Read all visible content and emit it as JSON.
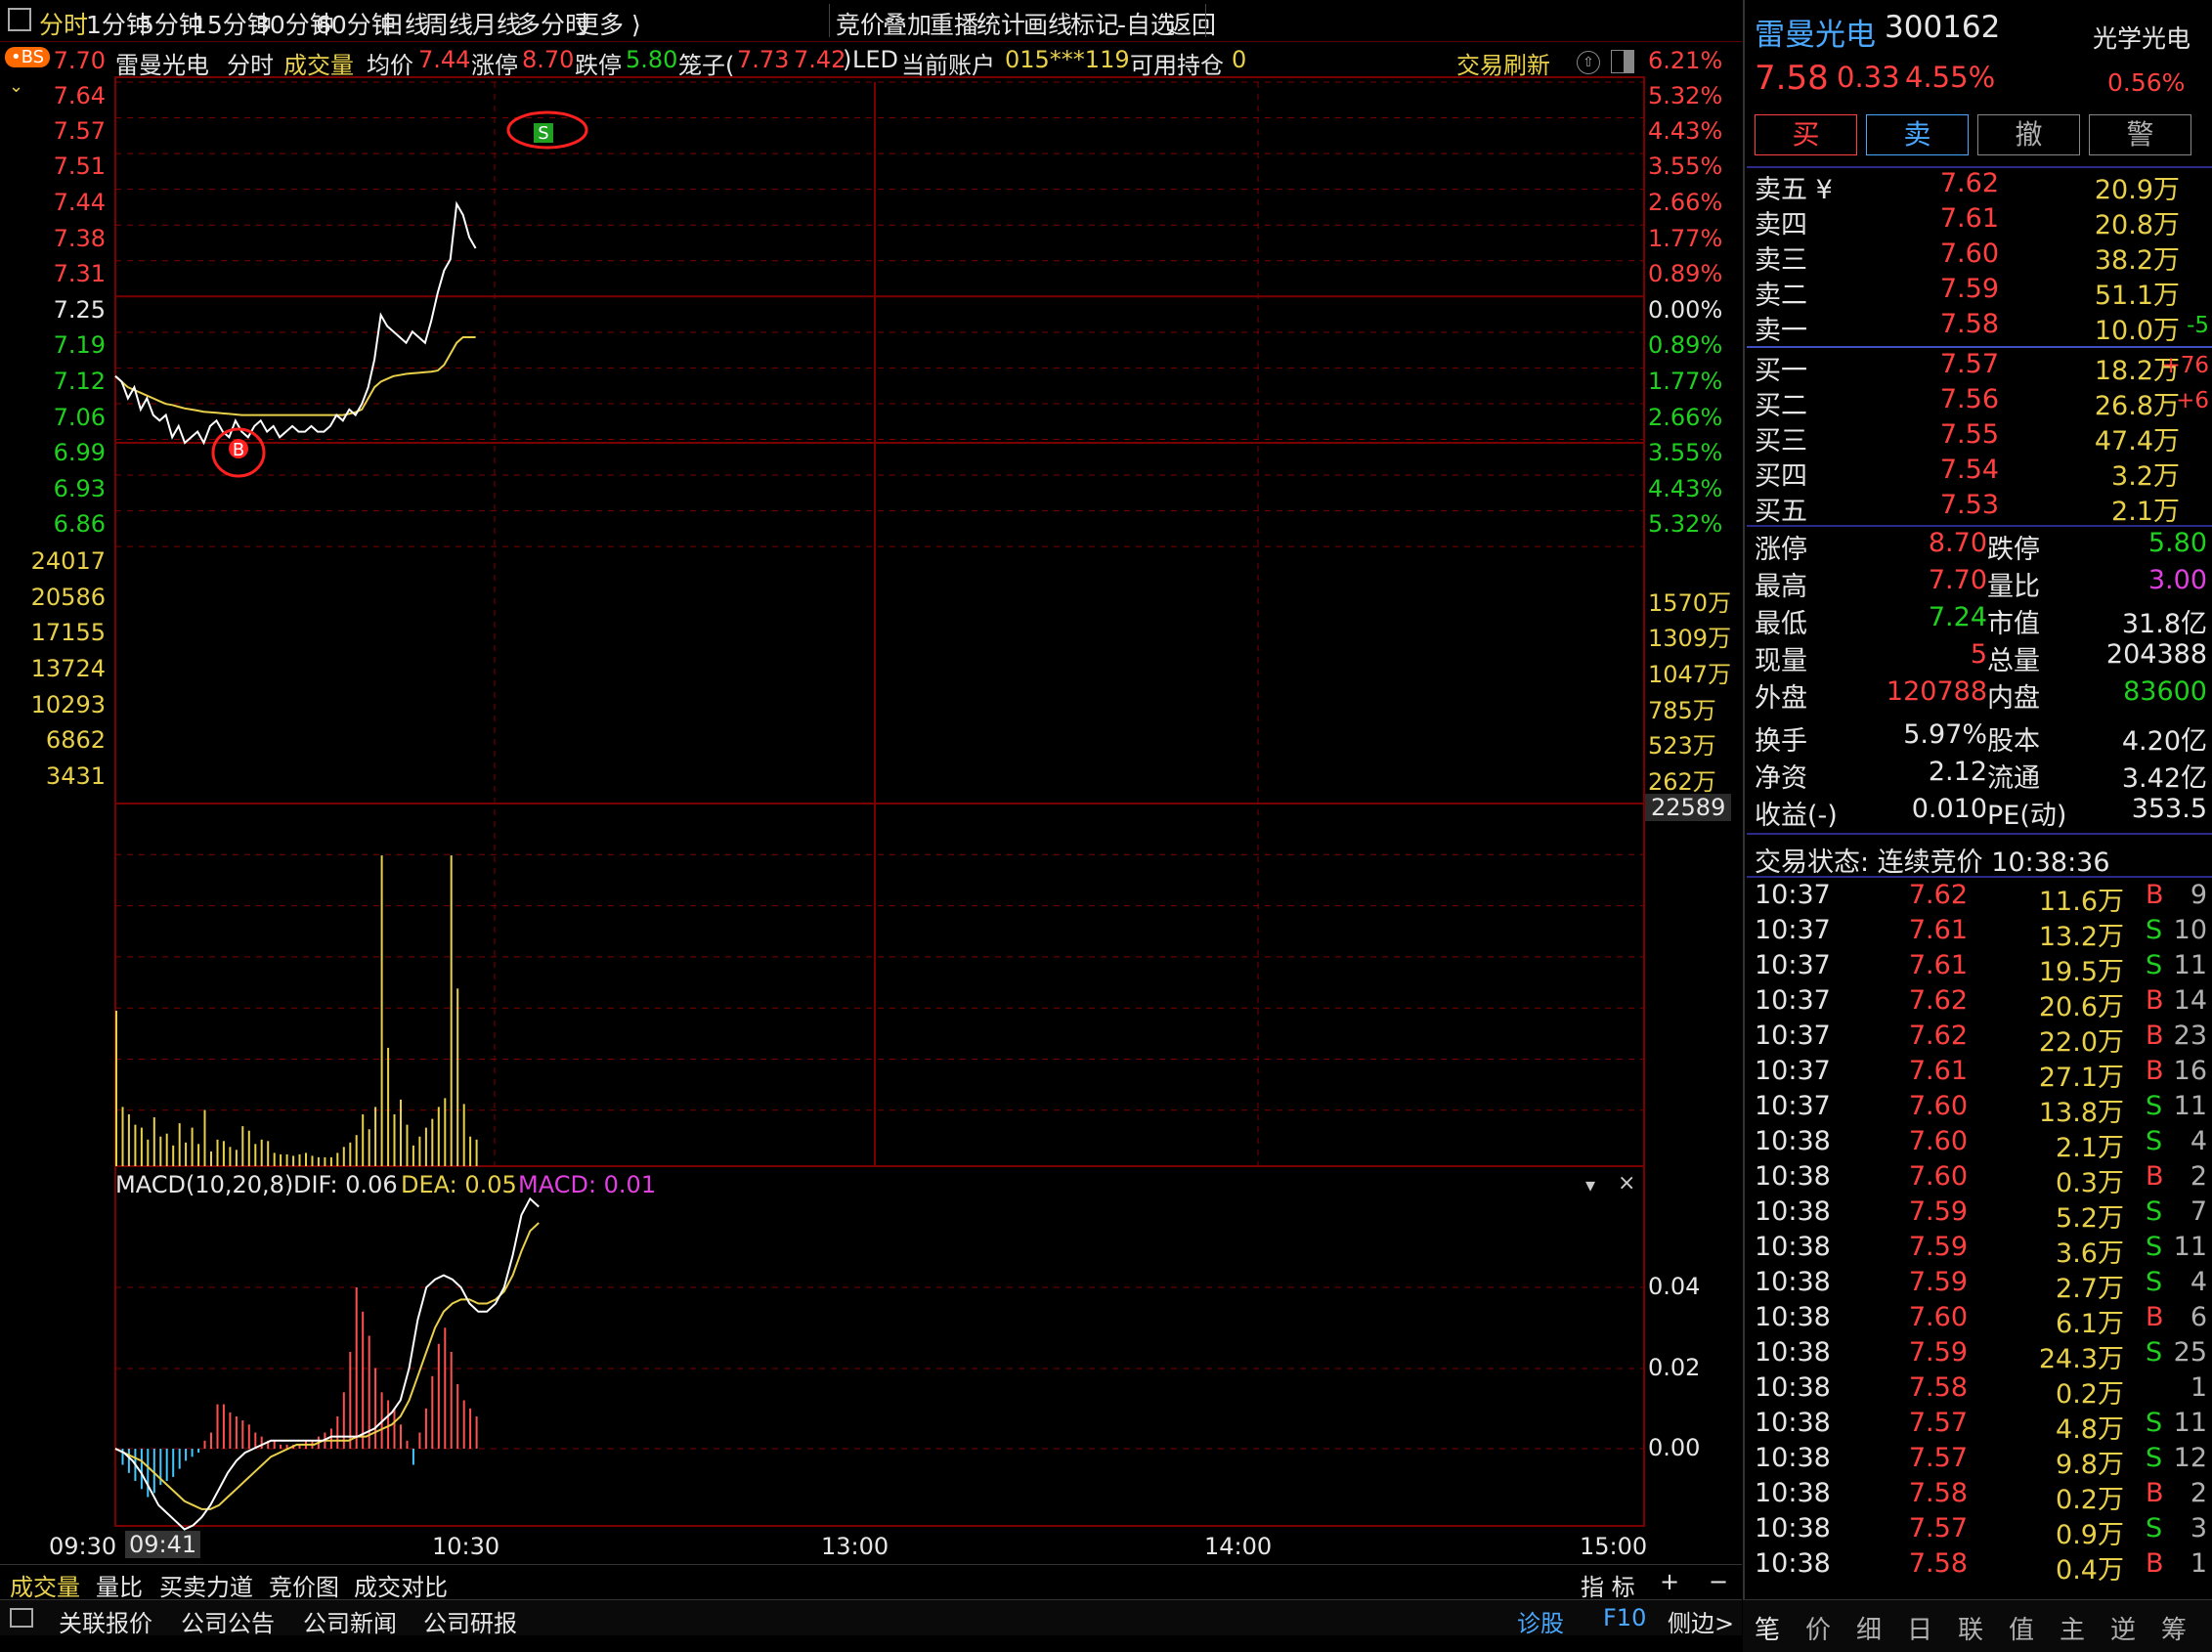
{
  "top_tabs": [
    "分时",
    "1分钟",
    "5分钟",
    "15分钟",
    "30分钟",
    "60分钟",
    "日线",
    "周线",
    "月线",
    "多分时",
    "更多 ⟩"
  ],
  "top_right_tabs": [
    "竞价",
    "叠加",
    "重播",
    "统计",
    "画线",
    "标记",
    "-自选",
    "返回"
  ],
  "bs_badge": "BS",
  "info": {
    "name": "雷曼光电",
    "mode": "分时",
    "indicator": "成交量",
    "avg_label": "均价",
    "avg_value": "7.44",
    "limit_up_label": "涨停",
    "limit_up_value": "8.70",
    "limit_down_label": "跌停",
    "limit_down_value": "5.80",
    "cage_label": "笼子(",
    "cage_high": "7.73",
    "cage_low": "7.42",
    "cage_close": ")",
    "sector": "LED",
    "account_label": "当前账户",
    "account_value": "015***119",
    "position_label": "可用持仓",
    "position_value": "0",
    "refresh": "交易刷新"
  },
  "price_axis": {
    "left_red": [
      "7.70",
      "7.64",
      "7.57",
      "7.51",
      "7.44",
      "7.38",
      "7.31"
    ],
    "left_mid": "7.25",
    "left_green": [
      "7.19",
      "7.12",
      "7.06",
      "6.99",
      "6.93",
      "6.86"
    ],
    "right_red": [
      "6.21%",
      "5.32%",
      "4.43%",
      "3.55%",
      "2.66%",
      "1.77%",
      "0.89%"
    ],
    "right_mid": "0.00%",
    "right_green": [
      "0.89%",
      "1.77%",
      "2.66%",
      "3.55%",
      "4.43%",
      "5.32%"
    ]
  },
  "volume_axis": {
    "left": [
      "24017",
      "20586",
      "17155",
      "13724",
      "10293",
      "6862",
      "3431"
    ],
    "right_box": "22589",
    "right": [
      "1570万",
      "1309万",
      "1047万",
      "785万",
      "523万",
      "262万"
    ]
  },
  "macd": {
    "title": "MACD(10,20,8)",
    "dif": "DIF: 0.06",
    "dea": "DEA: 0.05",
    "macd": "MACD: 0.01",
    "axis": [
      "0.04",
      "0.02",
      "0.00"
    ]
  },
  "time_axis": {
    "t1": "09:30",
    "t1b": "09:41",
    "t2": "10:30",
    "t3": "13:00",
    "t4": "14:00",
    "t5": "15:00"
  },
  "bottom_tabs": [
    "成交量",
    "量比",
    "买卖力道",
    "竞价图",
    "成交对比"
  ],
  "bottom_right": {
    "ind": "指 标",
    "plus": "+",
    "minus": "−"
  },
  "footer_tabs": [
    "关联报价",
    "公司公告",
    "公司新闻",
    "公司研报"
  ],
  "footer_right": {
    "diag": "诊股",
    "f10": "F10",
    "side": "侧边>"
  },
  "stock": {
    "name": "雷曼光电",
    "code": "300162",
    "sector": "光学光电",
    "price": "7.58",
    "change": "0.33",
    "pct": "4.55%",
    "spread": "0.56%",
    "buttons": [
      "买",
      "卖",
      "撤",
      "警"
    ]
  },
  "asks": [
    {
      "label": "卖五 ¥",
      "price": "7.62",
      "vol": "20.9万",
      "chg": ""
    },
    {
      "label": "卖四",
      "price": "7.61",
      "vol": "20.8万",
      "chg": ""
    },
    {
      "label": "卖三",
      "price": "7.60",
      "vol": "38.2万",
      "chg": ""
    },
    {
      "label": "卖二",
      "price": "7.59",
      "vol": "51.1万",
      "chg": ""
    },
    {
      "label": "卖一",
      "price": "7.58",
      "vol": "10.0万",
      "chg": "-5"
    }
  ],
  "bids": [
    {
      "label": "买一",
      "price": "7.57",
      "vol": "18.2万",
      "chg": "+76"
    },
    {
      "label": "买二",
      "price": "7.56",
      "vol": "26.8万",
      "chg": "+6"
    },
    {
      "label": "买三",
      "price": "7.55",
      "vol": "47.4万",
      "chg": ""
    },
    {
      "label": "买四",
      "price": "7.54",
      "vol": "3.2万",
      "chg": ""
    },
    {
      "label": "买五",
      "price": "7.53",
      "vol": "2.1万",
      "chg": ""
    }
  ],
  "stats": [
    {
      "l1": "涨停",
      "v1": "8.70",
      "c1": "red",
      "l2": "跌停",
      "v2": "5.80",
      "c2": "green"
    },
    {
      "l1": "最高",
      "v1": "7.70",
      "c1": "red",
      "l2": "量比",
      "v2": "3.00",
      "c2": "magenta"
    },
    {
      "l1": "最低",
      "v1": "7.24",
      "c1": "green",
      "l2": "市值",
      "v2": "31.8亿",
      "c2": "white"
    },
    {
      "l1": "现量",
      "v1": "5",
      "c1": "red",
      "l2": "总量",
      "v2": "204388",
      "c2": "white"
    },
    {
      "l1": "外盘",
      "v1": "120788",
      "c1": "red",
      "l2": "内盘",
      "v2": "83600",
      "c2": "green"
    }
  ],
  "stats2": [
    {
      "l1": "换手",
      "v1": "5.97%",
      "l2": "股本",
      "v2": "4.20亿"
    },
    {
      "l1": "净资",
      "v1": "2.12",
      "l2": "流通",
      "v2": "3.42亿"
    },
    {
      "l1": "收益(-)",
      "v1": "0.010",
      "l2": "PE(动)",
      "v2": "353.5"
    }
  ],
  "trade_status": "交易状态: 连续竞价 10:38:36",
  "ticks": [
    {
      "t": "10:37",
      "p": "7.62",
      "v": "11.6万",
      "s": "B",
      "n": "9"
    },
    {
      "t": "10:37",
      "p": "7.61",
      "v": "13.2万",
      "s": "S",
      "n": "10"
    },
    {
      "t": "10:37",
      "p": "7.61",
      "v": "19.5万",
      "s": "S",
      "n": "11"
    },
    {
      "t": "10:37",
      "p": "7.62",
      "v": "20.6万",
      "s": "B",
      "n": "14"
    },
    {
      "t": "10:37",
      "p": "7.62",
      "v": "22.0万",
      "s": "B",
      "n": "23"
    },
    {
      "t": "10:37",
      "p": "7.61",
      "v": "27.1万",
      "s": "B",
      "n": "16"
    },
    {
      "t": "10:37",
      "p": "7.60",
      "v": "13.8万",
      "s": "S",
      "n": "11"
    },
    {
      "t": "10:38",
      "p": "7.60",
      "v": "2.1万",
      "s": "S",
      "n": "4"
    },
    {
      "t": "10:38",
      "p": "7.60",
      "v": "0.3万",
      "s": "B",
      "n": "2"
    },
    {
      "t": "10:38",
      "p": "7.59",
      "v": "5.2万",
      "s": "S",
      "n": "7"
    },
    {
      "t": "10:38",
      "p": "7.59",
      "v": "3.6万",
      "s": "S",
      "n": "11"
    },
    {
      "t": "10:38",
      "p": "7.59",
      "v": "2.7万",
      "s": "S",
      "n": "4"
    },
    {
      "t": "10:38",
      "p": "7.60",
      "v": "6.1万",
      "s": "B",
      "n": "6"
    },
    {
      "t": "10:38",
      "p": "7.59",
      "v": "24.3万",
      "s": "S",
      "n": "25"
    },
    {
      "t": "10:38",
      "p": "7.58",
      "v": "0.2万",
      "s": "",
      "n": "1"
    },
    {
      "t": "10:38",
      "p": "7.57",
      "v": "4.8万",
      "s": "S",
      "n": "11"
    },
    {
      "t": "10:38",
      "p": "7.57",
      "v": "9.8万",
      "s": "S",
      "n": "12"
    },
    {
      "t": "10:38",
      "p": "7.58",
      "v": "0.2万",
      "s": "B",
      "n": "2"
    },
    {
      "t": "10:38",
      "p": "7.57",
      "v": "0.9万",
      "s": "S",
      "n": "3"
    },
    {
      "t": "10:38",
      "p": "7.58",
      "v": "0.4万",
      "s": "B",
      "n": "1"
    }
  ],
  "side_tabs": [
    "笔",
    "价",
    "细",
    "日",
    "联",
    "值",
    "主",
    "逆",
    "筹"
  ],
  "markers": {
    "buy": "B",
    "sell": "S"
  },
  "colors": {
    "up": "#ff4040",
    "down": "#20d020",
    "avg": "#e8d04a",
    "price": "#ffffff",
    "grid": "#7a0000",
    "vol": "#e8d04a"
  }
}
